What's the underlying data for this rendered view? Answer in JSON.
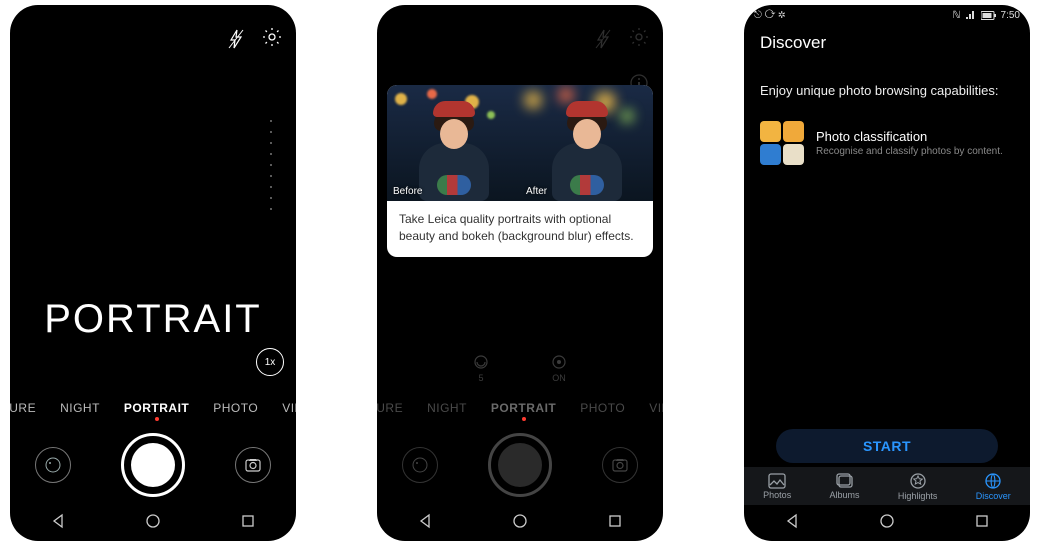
{
  "phone1": {
    "zoom": "1x",
    "mode_hero": "PORTRAIT",
    "modes": [
      "ERTURE",
      "NIGHT",
      "PORTRAIT",
      "PHOTO",
      "VIDEO"
    ],
    "active_mode_index": 2
  },
  "phone2": {
    "card": {
      "before_label": "Before",
      "after_label": "After",
      "text": "Take Leica quality portraits with optional beauty and bokeh (background blur) effects."
    },
    "ctrl": {
      "a_label": "5",
      "b_label": "ON"
    },
    "modes": [
      "ERTURE",
      "NIGHT",
      "PORTRAIT",
      "PHOTO",
      "VIDEO"
    ],
    "active_mode_index": 2
  },
  "phone3": {
    "status": {
      "left": "⎋ ⟳ ✲",
      "nfc": "ℕ",
      "batt": "▮",
      "time": "7:50"
    },
    "title": "Discover",
    "intro": "Enjoy unique photo browsing capabilities:",
    "feature": {
      "title": "Photo classification",
      "sub": "Recognise and classify photos by content."
    },
    "start": "START",
    "tabs": [
      {
        "label": "Photos",
        "active": false
      },
      {
        "label": "Albums",
        "active": false
      },
      {
        "label": "Highlights",
        "active": false
      },
      {
        "label": "Discover",
        "active": true
      }
    ]
  }
}
